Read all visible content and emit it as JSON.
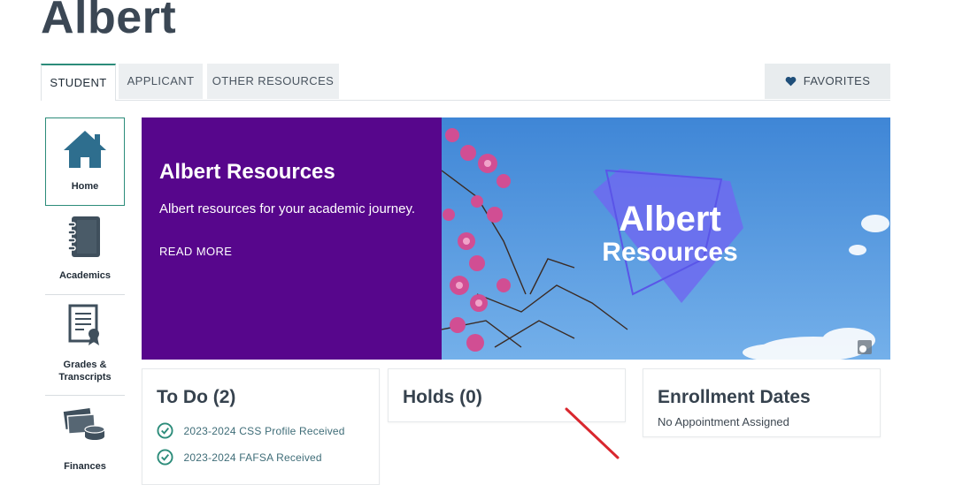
{
  "app": {
    "title": "Albert"
  },
  "tabs": [
    {
      "label": "STUDENT",
      "active": true
    },
    {
      "label": "APPLICANT",
      "active": false
    },
    {
      "label": "OTHER RESOURCES",
      "active": false
    }
  ],
  "favorites": {
    "label": "FAVORITES",
    "icon": "heart-icon"
  },
  "sidebar": {
    "items": [
      {
        "label": "Home",
        "icon": "home-icon"
      },
      {
        "label": "Academics",
        "icon": "notebook-icon"
      },
      {
        "label_line1": "Grades &",
        "label_line2": "Transcripts",
        "icon": "certificate-icon"
      },
      {
        "label": "Finances",
        "icon": "money-icon"
      }
    ]
  },
  "hero": {
    "title": "Albert Resources",
    "text": "Albert resources for your academic journey.",
    "link": "READ MORE",
    "logo_line1": "Albert",
    "logo_line2": "Resources"
  },
  "todo": {
    "title": "To Do (2)",
    "items": [
      {
        "label": "2023-2024 CSS Profile Received"
      },
      {
        "label": "2023-2024 FAFSA Received"
      }
    ]
  },
  "holds": {
    "title": "Holds (0)"
  },
  "enrollment": {
    "title": "Enrollment Dates",
    "subtitle": "No Appointment Assigned"
  },
  "colors": {
    "brand_purple": "#57068c",
    "accent_teal": "#2c8c7a",
    "sky": "#4a90d9"
  }
}
